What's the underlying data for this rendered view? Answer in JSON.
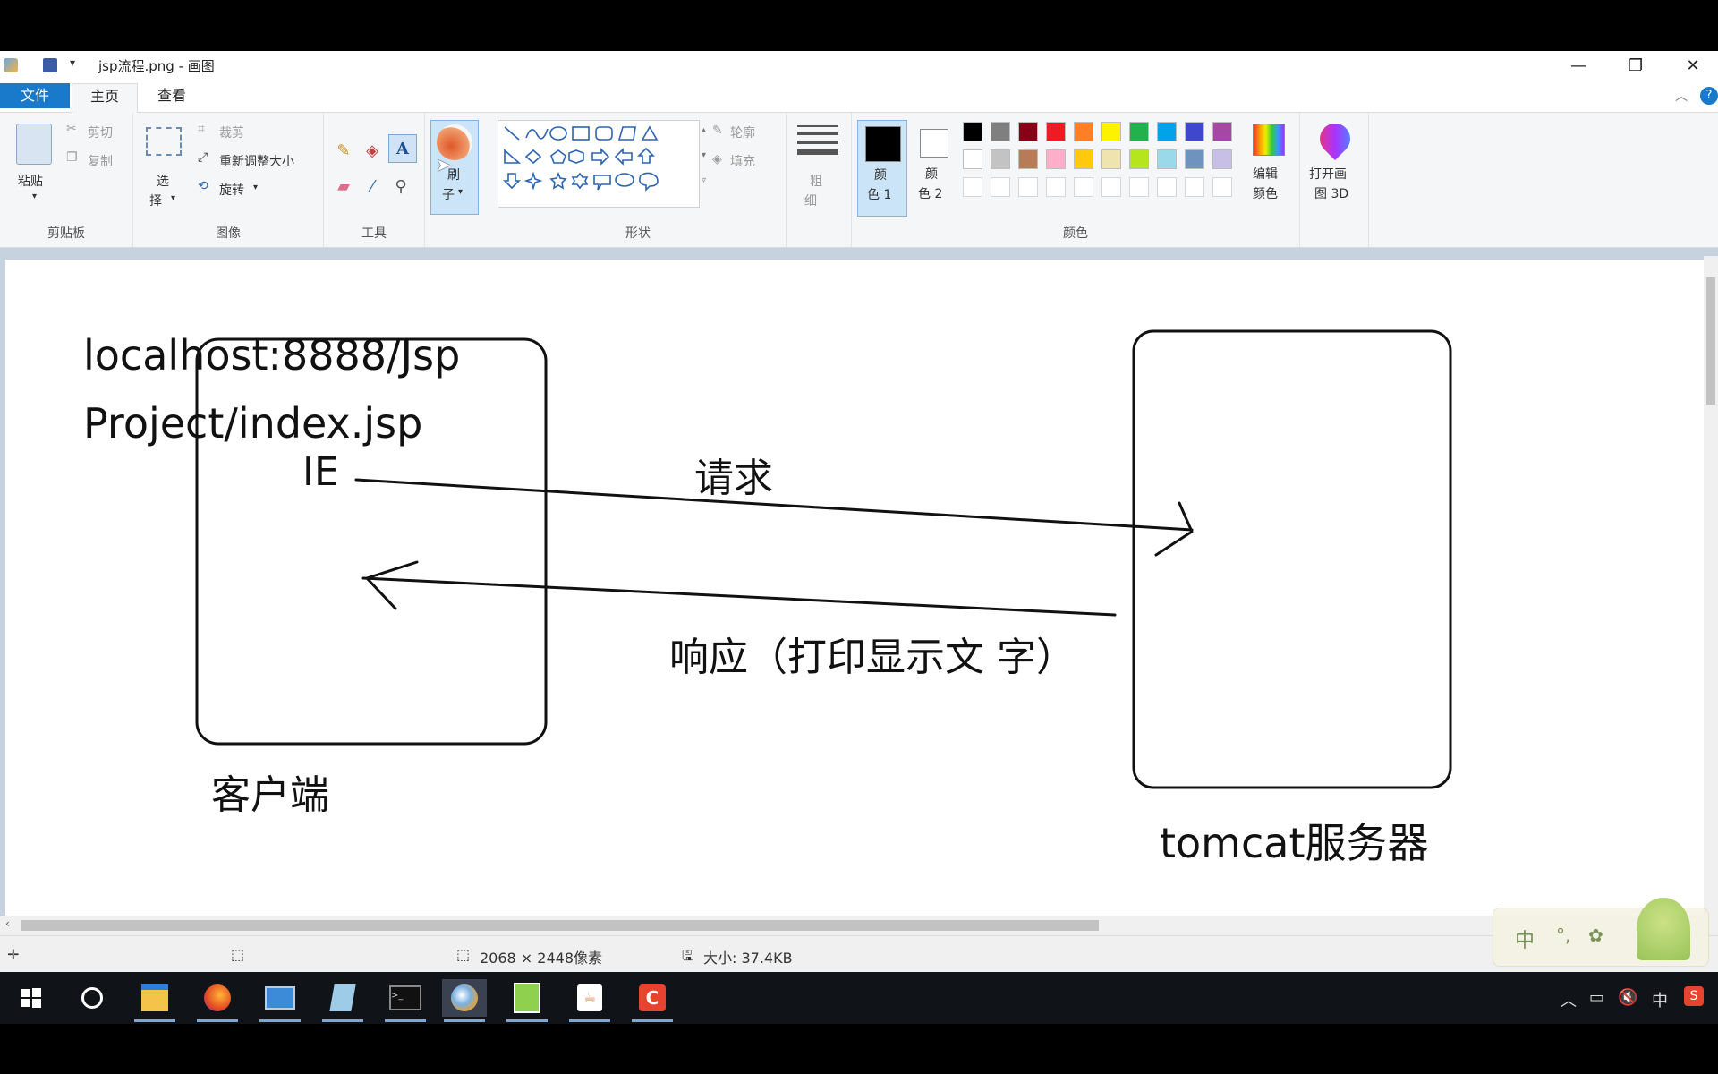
{
  "window": {
    "title": "jsp流程.png - 画图",
    "minimize": "—",
    "restore": "❐",
    "close": "✕"
  },
  "tabs": {
    "file": "文件",
    "home": "主页",
    "view": "查看"
  },
  "ribbon": {
    "clipboard": {
      "label": "剪贴板",
      "paste": "粘贴",
      "cut": "剪切",
      "copy": "复制"
    },
    "image": {
      "label": "图像",
      "select": "选",
      "select2": "择",
      "crop": "裁剪",
      "resize": "重新调整大小",
      "rotate": "旋转"
    },
    "tools": {
      "label": "工具"
    },
    "brushes": {
      "label1": "刷",
      "label2": "子"
    },
    "shapes": {
      "label": "形状",
      "outline": "轮廓",
      "fill": "填充"
    },
    "size": {
      "label1": "粗",
      "label2": "细"
    },
    "colors": {
      "label": "颜色",
      "color1": "颜",
      "color1b": "色 1",
      "color2": "颜",
      "color2b": "色 2",
      "edit1": "编辑",
      "edit2": "颜色",
      "palette_row1": [
        "#000000",
        "#7f7f7f",
        "#880015",
        "#ed1c24",
        "#ff7f27",
        "#fff200",
        "#22b14c",
        "#00a2e8",
        "#3f48cc",
        "#a349a4"
      ],
      "palette_row2": [
        "#ffffff",
        "#c3c3c3",
        "#b97a57",
        "#ffaec9",
        "#ffc90e",
        "#efe4b0",
        "#b5e61d",
        "#99d9ea",
        "#7092be",
        "#c8bfe7"
      ]
    },
    "paint3d": {
      "label1": "打开画",
      "label2": "图 3D"
    }
  },
  "drawing": {
    "url_line1": "localhost:8888/Jsp",
    "url_line2": "Project/index.jsp",
    "ie": "IE",
    "request": "请求",
    "response": "响应（打印显示文  字）",
    "client": "客户端",
    "server": "tomcat服务器"
  },
  "status": {
    "dimensions": "2068 × 2448像素",
    "size": "大小: 37.4KB"
  },
  "ime": {
    "mode": "中"
  },
  "tray": {
    "lang": "中"
  }
}
